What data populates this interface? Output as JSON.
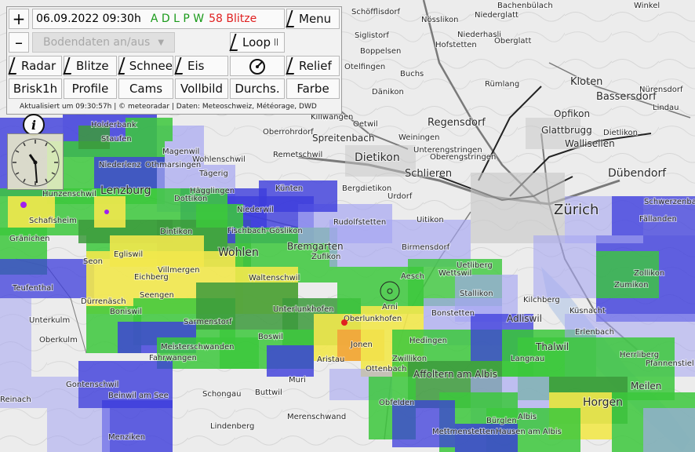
{
  "controls": {
    "plus": "+",
    "minus": "–",
    "datetime": "06.09.2022 09:30h",
    "lightning_sources": "A D L P W",
    "lightning_count": "58 Blitze",
    "menu": "Menu",
    "bodendaten": "Bodendaten an/aus",
    "loop": "Loop",
    "pause_symbol": "||",
    "radar": "Radar",
    "blitze": "Blitze",
    "schnee": "Schnee",
    "eis": "Eis",
    "relief": "Relief",
    "brisk": "Brisk1h",
    "profile": "Profile",
    "cams": "Cams",
    "vollbild": "Vollbild",
    "durchs": "Durchs.",
    "farbe": "Farbe",
    "status_line": "Aktualisiert um 09:30:57h | © meteoradar | Daten: Meteoschweiz, Météorage, DWD",
    "info_symbol": "i"
  },
  "colors": {
    "rain_light": "#a6a6f2",
    "rain_moderate": "#3c3cdc",
    "rain_green": "#3cc83c",
    "rain_dark_green": "#3c9a3c",
    "rain_yellow": "#f2e84c",
    "rain_orange": "#f2a43c",
    "lightning_green": "#1f9a1f",
    "lightning_red": "#e02020"
  },
  "map_labels": [
    "Schöfflisdorf",
    "Nösslikon",
    "Niederglatt",
    "Bachenbülach",
    "Winkel",
    "Siglistorf",
    "Niederhasli",
    "Oberglatt",
    "Boppelsen",
    "Hofstetten",
    "Otelfingen",
    "Buchs",
    "Rümlang",
    "Kloten",
    "Bassersdorf",
    "Nürensdorf",
    "Lindau",
    "Dänikon",
    "Killwangen",
    "Oetwil",
    "Regensdorf",
    "Opfikon",
    "Holderbank",
    "Staufen",
    "Magenwil",
    "Oberrohrdorf",
    "Spreitenbach",
    "Weiningen",
    "Glattbrugg",
    "Wallisellen",
    "Dietlikon",
    "Wohlenschwil",
    "Remetschwil",
    "Dietikon",
    "Unterengstringen",
    "Oberengstringen",
    "Niederlenz",
    "Othmarsingen",
    "Tägerig",
    "Schlieren",
    "Dübendorf",
    "Künten",
    "Bergdietikon",
    "Urdorf",
    "Hunzenschwil",
    "Lenzburg",
    "Hägglingen",
    "Dottikon",
    "Zürich",
    "Schafisheim",
    "Niederwil",
    "Uitikon",
    "Schwerzenbach",
    "Fällanden",
    "Gränichen",
    "Dintikon",
    "Fischbach-Göslikon",
    "Rudolfstetten",
    "Bremgarten",
    "Zufikon",
    "Birmensdorf",
    "Egliswil",
    "Wohlen",
    "Seon",
    "Uetliberg",
    "Wettswil",
    "Zollikon",
    "Zumikon",
    "Teufenthal",
    "Eichberg",
    "Villmergen",
    "Waltenschwil",
    "Aesch",
    "Stallikon",
    "Kilchberg",
    "Küsnacht",
    "Dürrenäsch",
    "Boniswil",
    "Seengen",
    "Sarmenstorf",
    "Unterlunkhofen",
    "Arni",
    "Oberlunkhofen",
    "Bonstetten",
    "Adliswil",
    "Erlenbach",
    "Unterkulm",
    "Oberkulm",
    "Meisterschwanden",
    "Boswil",
    "Hedingen",
    "Thalwil",
    "Herrliberg",
    "Jonen",
    "Zwillikon",
    "Langnau",
    "Fahrwangen",
    "Aristau",
    "Ottenbach",
    "Affoltern am Albis",
    "Pfannenstiel",
    "Meilen",
    "Gontenschwil",
    "Muri",
    "Schongau",
    "Buttwil",
    "Obfelden",
    "Horgen",
    "Beinwil am See",
    "Lindenberg",
    "Reinach",
    "Menziken",
    "Merenschwand",
    "Mettmenstetten",
    "Albis",
    "Bürglen",
    "Hausen am Albis"
  ]
}
